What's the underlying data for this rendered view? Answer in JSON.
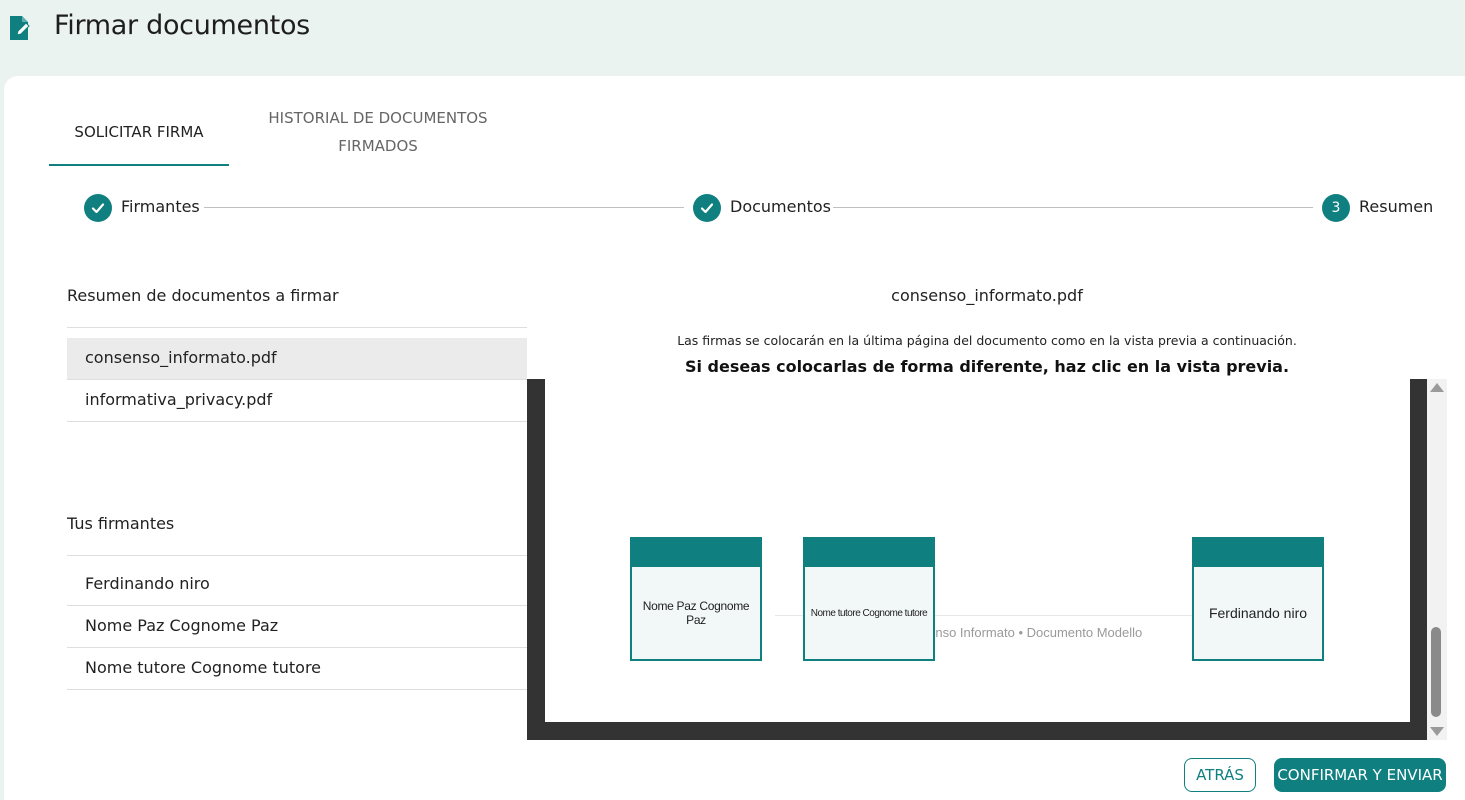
{
  "header": {
    "title": "Firmar documentos",
    "icon": "document-edit-icon"
  },
  "tabs": [
    {
      "label": "SOLICITAR FIRMA",
      "active": true
    },
    {
      "label": "HISTORIAL DE DOCUMENTOS FIRMADOS",
      "line1": "HISTORIAL DE DOCUMENTOS",
      "line2": "FIRMADOS",
      "active": false
    }
  ],
  "stepper": {
    "steps": [
      {
        "label": "Firmantes",
        "state": "completed",
        "icon": "check-icon"
      },
      {
        "label": "Documentos",
        "state": "completed",
        "icon": "check-icon"
      },
      {
        "label": "Resumen",
        "state": "current",
        "number": "3"
      }
    ]
  },
  "documents": {
    "title": "Resumen de documentos a firmar",
    "items": [
      "consenso_informato.pdf",
      "informativa_privacy.pdf"
    ],
    "selected": "consenso_informato.pdf"
  },
  "signers": {
    "title": "Tus firmantes",
    "items": [
      "Ferdinando niro",
      "Nome Paz Cognome Paz",
      "Nome tutore Cognome tutore"
    ]
  },
  "preview": {
    "title": "consenso_informato.pdf",
    "note": "Las firmas se colocarán en la última página del documento como en la vista previa a continuación.",
    "note_bold": "Si deseas colocarlas de forma diferente, haz clic en la vista previa.",
    "page_footer": "Consenso Informato • Documento Modello",
    "signature_boxes": [
      "Nome Paz Cognome Paz",
      "Nome tutore Cognome tutore",
      "Ferdinando niro"
    ]
  },
  "buttons": {
    "back": "ATRÁS",
    "confirm": "CONFIRMAR Y ENVIAR"
  },
  "colors": {
    "accent": "#0f7f80",
    "header_bg": "#ebf3f1",
    "preview_frame": "#333333"
  }
}
